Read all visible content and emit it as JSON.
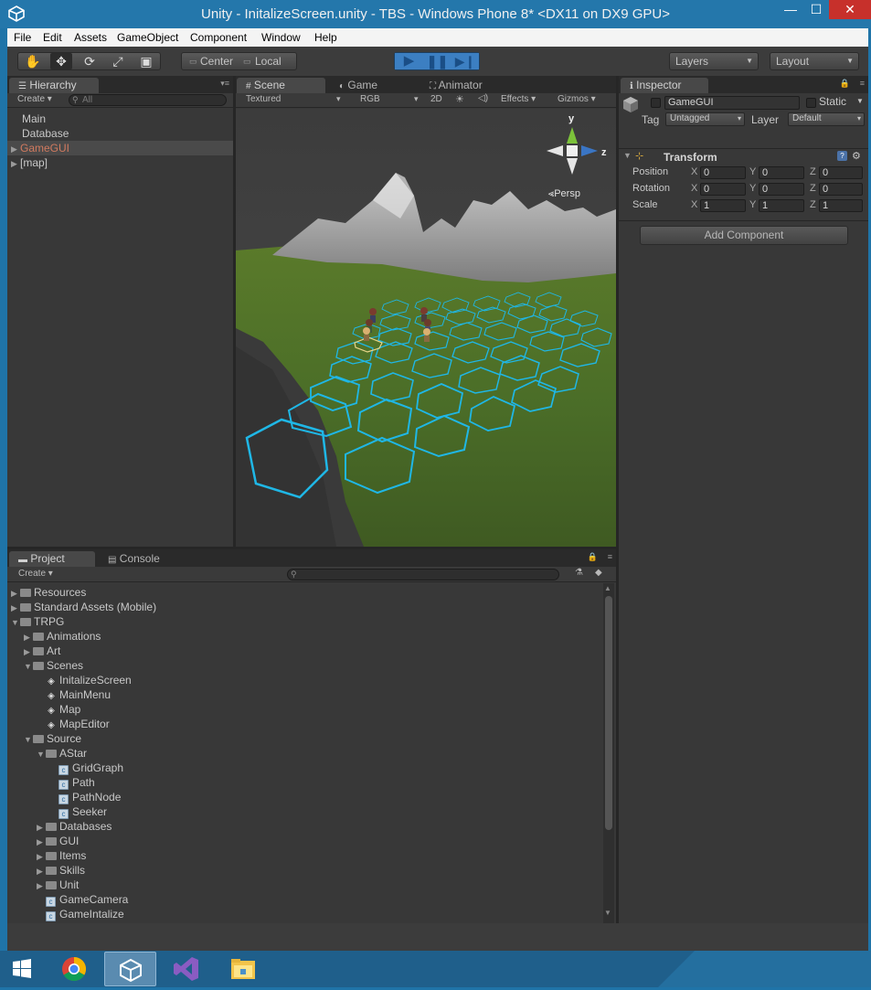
{
  "window": {
    "title": "Unity - InitalizeScreen.unity - TBS - Windows Phone 8* <DX11 on DX9 GPU>",
    "min": "—",
    "max": "☐",
    "close": "✕"
  },
  "menu": [
    "File",
    "Edit",
    "Assets",
    "GameObject",
    "Component",
    "Window",
    "Help"
  ],
  "toolbar": {
    "center": "Center",
    "local": "Local",
    "layers": "Layers",
    "layout": "Layout"
  },
  "hierarchy": {
    "tab": "Hierarchy",
    "create": "Create",
    "search_placeholder": "All",
    "items": [
      "Main",
      "Database",
      "GameGUI",
      "[map]"
    ]
  },
  "scene": {
    "tabs": [
      "Scene",
      "Game",
      "Animator"
    ],
    "shading": "Textured",
    "render_mode": "RGB",
    "mode_2d": "2D",
    "effects": "Effects",
    "gizmos": "Gizmos",
    "gizmo": {
      "y": "y",
      "z": "z",
      "persp": "Persp"
    }
  },
  "project": {
    "tabs": [
      "Project",
      "Console"
    ],
    "create": "Create",
    "tree": [
      {
        "label": "Resources",
        "type": "folder",
        "level": 0,
        "open": false
      },
      {
        "label": "Standard Assets (Mobile)",
        "type": "folder",
        "level": 0,
        "open": false
      },
      {
        "label": "TRPG",
        "type": "folder",
        "level": 0,
        "open": true
      },
      {
        "label": "Animations",
        "type": "folder",
        "level": 1,
        "open": false
      },
      {
        "label": "Art",
        "type": "folder",
        "level": 1,
        "open": false
      },
      {
        "label": "Scenes",
        "type": "folder",
        "level": 1,
        "open": true
      },
      {
        "label": "InitalizeScreen",
        "type": "scene",
        "level": 2
      },
      {
        "label": "MainMenu",
        "type": "scene",
        "level": 2
      },
      {
        "label": "Map",
        "type": "scene",
        "level": 2
      },
      {
        "label": "MapEditor",
        "type": "scene",
        "level": 2
      },
      {
        "label": "Source",
        "type": "folder",
        "level": 1,
        "open": true
      },
      {
        "label": "AStar",
        "type": "folder",
        "level": 2,
        "open": true
      },
      {
        "label": "GridGraph",
        "type": "script",
        "level": 3
      },
      {
        "label": "Path",
        "type": "script",
        "level": 3
      },
      {
        "label": "PathNode",
        "type": "script",
        "level": 3
      },
      {
        "label": "Seeker",
        "type": "script",
        "level": 3
      },
      {
        "label": "Databases",
        "type": "folder",
        "level": 2,
        "open": false
      },
      {
        "label": "GUI",
        "type": "folder",
        "level": 2,
        "open": false
      },
      {
        "label": "Items",
        "type": "folder",
        "level": 2,
        "open": false
      },
      {
        "label": "Skills",
        "type": "folder",
        "level": 2,
        "open": false
      },
      {
        "label": "Unit",
        "type": "folder",
        "level": 2,
        "open": false
      },
      {
        "label": "GameCamera",
        "type": "script",
        "level": 2
      },
      {
        "label": "GameIntalize",
        "type": "script",
        "level": 2
      }
    ]
  },
  "inspector": {
    "tab": "Inspector",
    "object_name": "GameGUI",
    "static_label": "Static",
    "tag_label": "Tag",
    "tag_value": "Untagged",
    "layer_label": "Layer",
    "layer_value": "Default",
    "transform_title": "Transform",
    "rows": [
      {
        "label": "Position",
        "x": "0",
        "y": "0",
        "z": "0"
      },
      {
        "label": "Rotation",
        "x": "0",
        "y": "0",
        "z": "0"
      },
      {
        "label": "Scale",
        "x": "1",
        "y": "1",
        "z": "1"
      }
    ],
    "axis_x": "X",
    "axis_y": "Y",
    "axis_z": "Z",
    "add_component": "Add Component"
  },
  "colors": {
    "titlebar": "#2477ab",
    "play_active": "#3c7fc2",
    "hex_grid": "#1fb7e6",
    "selected_item": "#d07a5f"
  }
}
